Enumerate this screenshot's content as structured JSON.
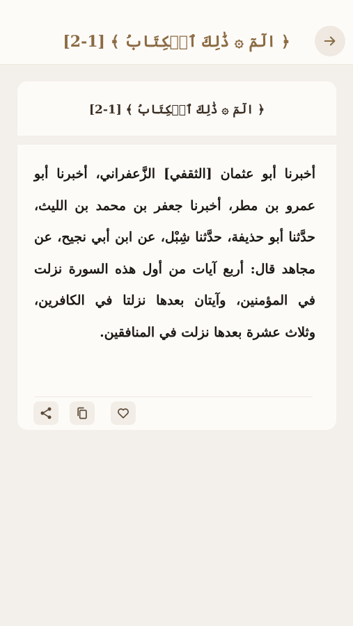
{
  "header": {
    "title": "﴿ الٓمٓ ۞ ذَٰلِكَ ٱلۡكِتَابُ ﴾ [1-2]"
  },
  "card": {
    "title": "﴿ الٓمٓ ۞ ذَٰلِكَ ٱلۡكِتَابُ ﴾ [1-2]",
    "text": "أخبرنا أبو عثمان [الثقفي] الزَّعفراني، أخبرنا أبو عمرو بن مطر، أخبرنا جعفر بن محمد بن الليث، حدَّثنا أبو حذيفة، حدَّثنا شِبْل، عن ابن أبي نجيح، عن مجاهد قال: أربع آيات من أول هذه السورة نزلت في المؤمنين، وآيتان بعدها نزلتا في الكافرين، وثلاث عشرة بعدها نزلت في المنافقين."
  },
  "icons": {
    "back": "arrow-right-icon",
    "share": "share-icon",
    "copy": "copy-icon",
    "favorite": "heart-icon"
  },
  "colors": {
    "accent": "#8b6b43",
    "background": "#f3efea",
    "card": "#fdfbf8"
  }
}
